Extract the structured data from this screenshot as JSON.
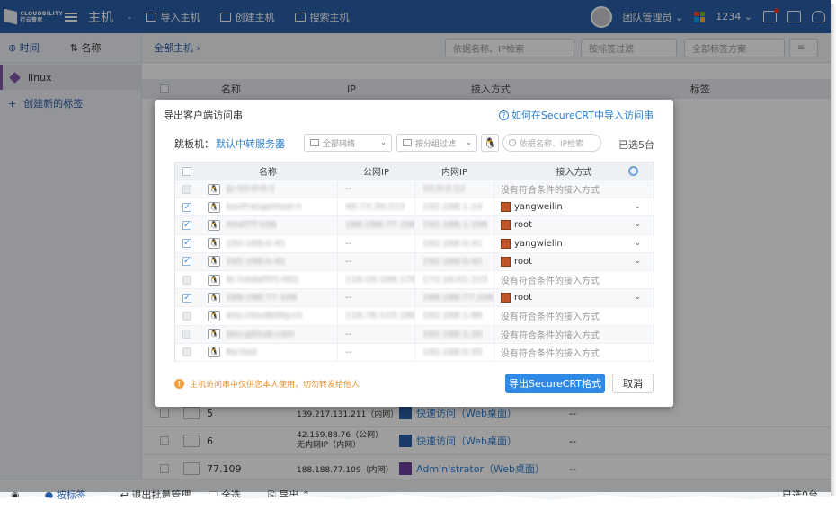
{
  "topbar": {
    "logo_text": "CLOUDBILITY",
    "logo_sub": "行云管家",
    "app_title": "主机",
    "nav": [
      {
        "label": "导入主机",
        "icon": "monitor-icon"
      },
      {
        "label": "创建主机",
        "icon": "monitor-add-icon"
      },
      {
        "label": "搜索主机",
        "icon": "monitor-search-icon"
      }
    ],
    "user": "团队管理员",
    "team_id": "1234"
  },
  "sidebar": {
    "time_label": "时间",
    "name_label": "名称",
    "tag": "linux",
    "new_tag": "创建新的标签"
  },
  "main": {
    "breadcrumb": "全部主机",
    "search_placeholder": "依据名称、IP检索",
    "tag_filter": "按标签过滤",
    "tag_scheme": "全部标签方案",
    "columns": [
      "名称",
      "IP",
      "接入方式",
      "标签"
    ],
    "rows": [
      {
        "name": "5",
        "ip": "139.217.131.211（内网）",
        "ip2": "",
        "access": "快速访问（Web桌面）",
        "tag": "--"
      },
      {
        "name": "6",
        "ip": "42.159.88.76（公网）",
        "ip2": "无内网IP（内网）",
        "access": "快速访问（Web桌面）",
        "tag": "--"
      },
      {
        "name": "77.109",
        "ip": "188.188.77.109（内网）",
        "ip2": "",
        "access": "Administrator（Web桌面）",
        "tag": "--"
      }
    ]
  },
  "bottombar": {
    "by_tag": "按标签",
    "batch_manage": "退出批量管理",
    "select_all": "全选",
    "export": "导出",
    "selected": "已选0台"
  },
  "modal": {
    "title": "导出客户端访问串",
    "help_link": "如何在SecureCRT中导入访问串",
    "jump_label": "跳板机：",
    "jump_value": "默认中转服务器",
    "network_select": "全部网络",
    "group_filter": "按分组过滤",
    "search_placeholder": "依据名称、IP检索",
    "selected_count": "已选5台",
    "columns": {
      "name": "名称",
      "public_ip": "公网IP",
      "private_ip": "内网IP",
      "access": "接入方式"
    },
    "rows": [
      {
        "checked": false,
        "enabled": false,
        "name": "ip-10-0-0-1",
        "public_ip": "--",
        "private_ip": "10.0.0.12",
        "access": "没有符合条件的接入方式",
        "has_dropdown": false
      },
      {
        "checked": true,
        "enabled": true,
        "name": "boxFrangeHost-n",
        "public_ip": "40.73.30.213",
        "private_ip": "192.168.1.14",
        "access": "yangweilin",
        "has_dropdown": true
      },
      {
        "checked": true,
        "enabled": true,
        "name": "HostTT-106",
        "public_ip": "188.188.77.106",
        "private_ip": "192.168.1.106",
        "access": "root",
        "has_dropdown": true
      },
      {
        "checked": true,
        "enabled": true,
        "name": "192.168.0.41",
        "public_ip": "--",
        "private_ip": "192.168.0.41",
        "access": "yangwielin",
        "has_dropdown": true
      },
      {
        "checked": true,
        "enabled": true,
        "name": "192.168.0.42",
        "public_ip": "--",
        "private_ip": "192.168.0.42",
        "access": "root",
        "has_dropdown": true
      },
      {
        "checked": false,
        "enabled": false,
        "name": "ib-1stdsf5f1-001",
        "public_ip": "118.24.166.178",
        "private_ip": "172.16.01.115",
        "access": "没有符合条件的接入方式",
        "has_dropdown": false
      },
      {
        "checked": true,
        "enabled": true,
        "name": "188.188.77.106",
        "public_ip": "--",
        "private_ip": "188.188.77.106",
        "access": "root",
        "has_dropdown": true
      },
      {
        "checked": false,
        "enabled": false,
        "name": "ans.cloudbility.cn",
        "public_ip": "118.76.115.180",
        "private_ip": "192.168.1.86",
        "access": "没有符合条件的接入方式",
        "has_dropdown": false
      },
      {
        "checked": false,
        "enabled": false,
        "name": "dev.github.com",
        "public_ip": "--",
        "private_ip": "192.168.1.20",
        "access": "没有符合条件的接入方式",
        "has_dropdown": false
      },
      {
        "checked": false,
        "enabled": false,
        "name": "Ra-test",
        "public_ip": "--",
        "private_ip": "192.168.0.55",
        "access": "没有符合条件的接入方式",
        "has_dropdown": false
      }
    ],
    "warning": "主机访问串中仅供您本人使用，切勿转发给他人",
    "export_button": "导出SecureCRT格式",
    "cancel_button": "取消"
  },
  "colors": {
    "topbar": "#2a5ea7",
    "link": "#2a7fd4",
    "primary_button": "#2e8ae6",
    "warning": "#e7922c",
    "tag_purple": "#7f5aa5"
  }
}
